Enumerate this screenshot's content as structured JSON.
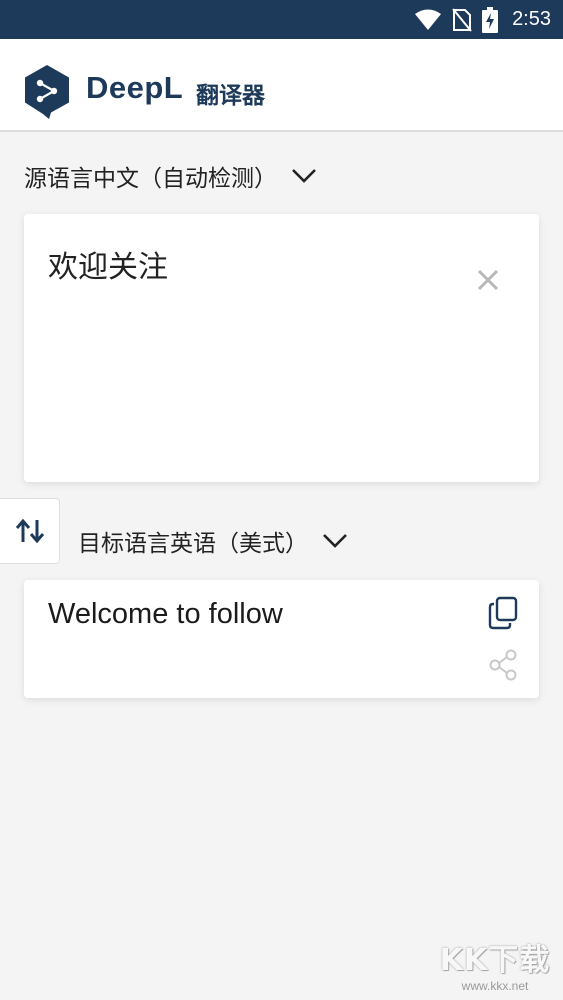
{
  "status_bar": {
    "time": "2:53",
    "icons": [
      "wifi-icon",
      "no-sim-icon",
      "battery-charging-icon"
    ],
    "background": "#1e3a5b"
  },
  "header": {
    "brand": "DeepL",
    "subtitle": "翻译器",
    "logo_icon": "deepl-logo-icon",
    "brand_color": "#1e3a5b"
  },
  "source": {
    "lang_label": "源语言中文（自动检测）",
    "text": "欢迎关注",
    "clear_icon": "close-icon"
  },
  "swap": {
    "icon": "swap-vertical-icon"
  },
  "target": {
    "lang_label": "目标语言英语（美式）",
    "text": "Welcome to follow",
    "copy_icon": "copy-icon",
    "share_icon": "share-icon"
  },
  "watermark": {
    "logo": "KK下载",
    "url": "www.kkx.net"
  }
}
